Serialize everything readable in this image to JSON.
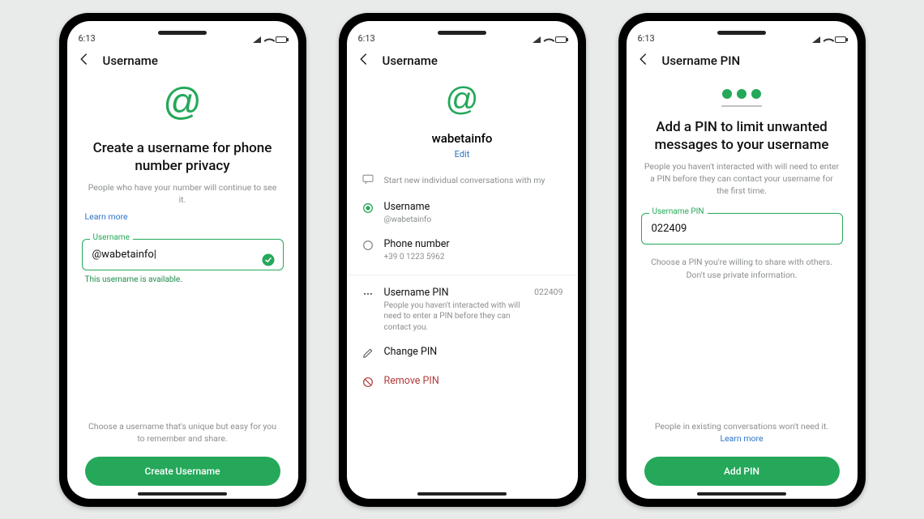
{
  "statusbar": {
    "time": "6:13"
  },
  "phone1": {
    "appbar_title": "Username",
    "title": "Create a username for phone number privacy",
    "subtitle": "People who have your number will continue to see it.",
    "learn_more": "Learn more",
    "field_label": "Username",
    "field_value": "@wabetainfo|",
    "helper": "This username is available.",
    "footnote": "Choose a username that's unique but easy for you to remember and share.",
    "button": "Create Username"
  },
  "phone2": {
    "appbar_title": "Username",
    "display_name": "wabetainfo",
    "edit": "Edit",
    "section_label": "Start new individual conversations with my",
    "opt_username_title": "Username",
    "opt_username_sub": "@wabetainfo",
    "opt_phone_title": "Phone number",
    "opt_phone_sub": "+39 0 1223 5962",
    "pin_row_title": "Username PIN",
    "pin_row_value": "022409",
    "pin_row_sub": "People you haven't interacted with will need to enter a PIN before they can contact you.",
    "change_pin": "Change PIN",
    "remove_pin": "Remove PIN"
  },
  "phone3": {
    "appbar_title": "Username PIN",
    "title": "Add a PIN to limit unwanted messages to your username",
    "subtitle": "People you haven't interacted with will need to enter a PIN before they can contact your username for the first time.",
    "field_label": "Username PIN",
    "field_value": "022409",
    "helper1": "Choose a PIN you're willing to share with others.",
    "helper2": "Don't use private information.",
    "footnote": "People in existing conversations won't need it.",
    "learn_more": "Learn more",
    "button": "Add PIN"
  }
}
